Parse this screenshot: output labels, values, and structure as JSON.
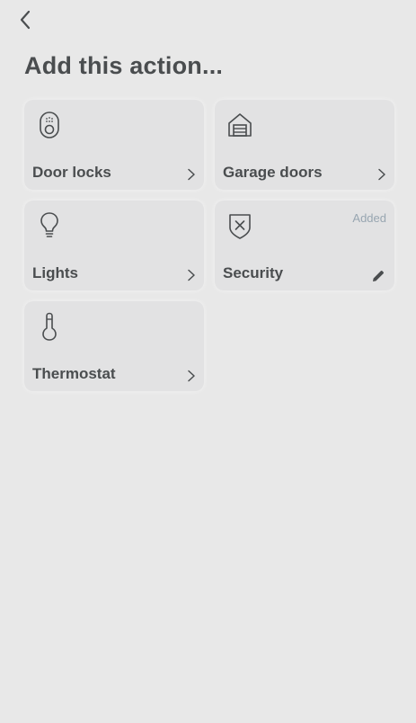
{
  "page": {
    "title": "Add this action..."
  },
  "actions": [
    {
      "label": "Door locks",
      "icon": "door-lock-icon",
      "trailing": "chevron-right-icon"
    },
    {
      "label": "Garage doors",
      "icon": "garage-icon",
      "trailing": "chevron-right-icon"
    },
    {
      "label": "Lights",
      "icon": "lightbulb-icon",
      "trailing": "chevron-right-icon"
    },
    {
      "label": "Security",
      "icon": "security-shield-icon",
      "trailing": "edit-pencil-icon",
      "badge": "Added"
    },
    {
      "label": "Thermostat",
      "icon": "thermometer-icon",
      "trailing": "chevron-right-icon"
    }
  ],
  "colors": {
    "background": "#e8e8e8",
    "card": "#e2e2e3",
    "text": "#4a4d4f",
    "badge": "#98a6b1"
  }
}
